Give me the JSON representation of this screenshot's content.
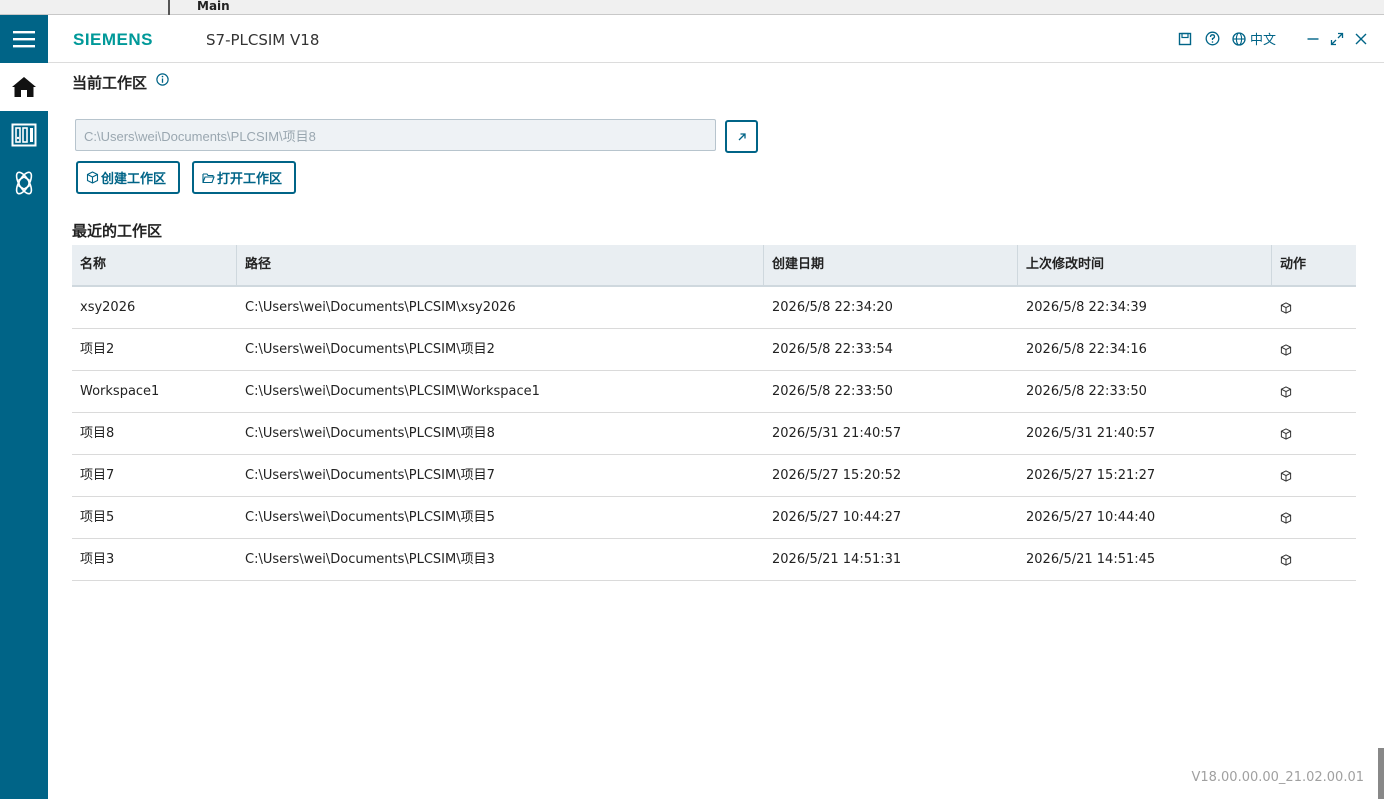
{
  "background": {
    "main_label": "Main"
  },
  "rail": {
    "items": [
      {
        "id": "menu",
        "icon": "hamburger-icon"
      },
      {
        "id": "home",
        "icon": "home-icon",
        "active": true
      },
      {
        "id": "instances",
        "icon": "plc-instances-icon"
      },
      {
        "id": "simulation",
        "icon": "atom-icon"
      }
    ]
  },
  "titlebar": {
    "logo": "SIEMENS",
    "app_title": "S7-PLCSIM V18",
    "language": "中文"
  },
  "workspace": {
    "current_title": "当前工作区",
    "path_value": "C:\\Users\\wei\\Documents\\PLCSIM\\项目8",
    "create_label": "创建工作区",
    "open_label": "打开工作区",
    "recent_title": "最近的工作区"
  },
  "table": {
    "headers": [
      "名称",
      "路径",
      "创建日期",
      "上次修改时间",
      "动作"
    ],
    "rows": [
      {
        "name": "xsy2026",
        "path": "C:\\Users\\wei\\Documents\\PLCSIM\\xsy2026",
        "created": "2026/5/8 22:34:20",
        "modified": "2026/5/8 22:34:39"
      },
      {
        "name": "项目2",
        "path": "C:\\Users\\wei\\Documents\\PLCSIM\\项目2",
        "created": "2026/5/8 22:33:54",
        "modified": "2026/5/8 22:34:16"
      },
      {
        "name": "Workspace1",
        "path": "C:\\Users\\wei\\Documents\\PLCSIM\\Workspace1",
        "created": "2026/5/8 22:33:50",
        "modified": "2026/5/8 22:33:50"
      },
      {
        "name": "项目8",
        "path": "C:\\Users\\wei\\Documents\\PLCSIM\\项目8",
        "created": "2026/5/31 21:40:57",
        "modified": "2026/5/31 21:40:57"
      },
      {
        "name": "项目7",
        "path": "C:\\Users\\wei\\Documents\\PLCSIM\\项目7",
        "created": "2026/5/27 15:20:52",
        "modified": "2026/5/27 15:21:27"
      },
      {
        "name": "项目5",
        "path": "C:\\Users\\wei\\Documents\\PLCSIM\\项目5",
        "created": "2026/5/27 10:44:27",
        "modified": "2026/5/27 10:44:40"
      },
      {
        "name": "项目3",
        "path": "C:\\Users\\wei\\Documents\\PLCSIM\\项目3",
        "created": "2026/5/21 14:51:31",
        "modified": "2026/5/21 14:51:45"
      }
    ]
  },
  "version": "V18.00.00.00_21.02.00.01",
  "colors": {
    "accent": "#006487",
    "logo": "#009999",
    "header_bg": "#e9eef2"
  }
}
